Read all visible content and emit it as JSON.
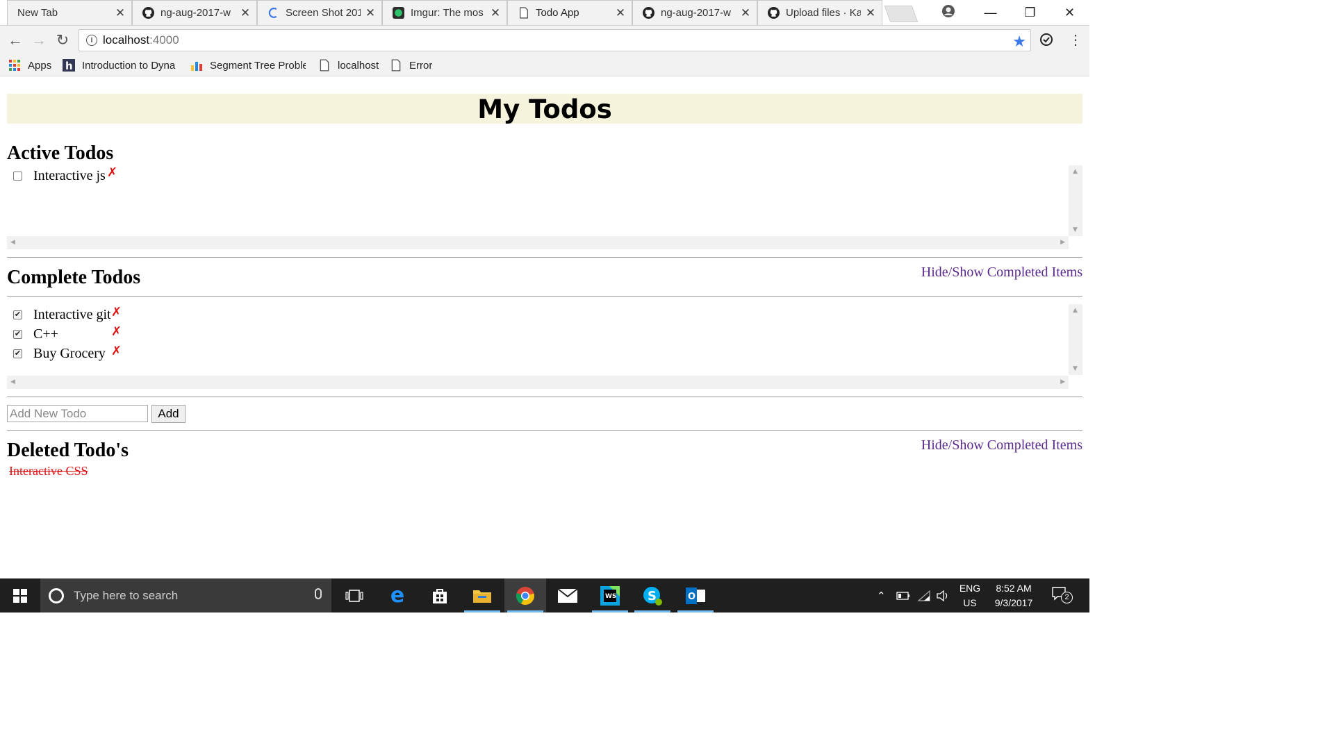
{
  "browser": {
    "tabs": [
      {
        "title": "New Tab",
        "icon": "none",
        "active": false
      },
      {
        "title": "ng-aug-2017-w",
        "icon": "github-icon",
        "active": false
      },
      {
        "title": "Screen Shot 201",
        "icon": "loading-icon",
        "active": false
      },
      {
        "title": "Imgur: The mos",
        "icon": "imgur-icon",
        "active": false
      },
      {
        "title": "Todo App",
        "icon": "page-icon",
        "active": true
      },
      {
        "title": "ng-aug-2017-w",
        "icon": "github-icon",
        "active": false
      },
      {
        "title": "Upload files · Ka",
        "icon": "github-icon",
        "active": false
      }
    ],
    "close_glyph": "✕",
    "address": {
      "host": "localhost",
      "port": ":4000"
    },
    "bookmarks": [
      {
        "label": "Apps",
        "icon": "apps-grid-icon"
      },
      {
        "label": "Introduction to Dyna",
        "icon": "hackerearth-icon"
      },
      {
        "label": "Segment Tree Proble",
        "icon": "bar-chart-icon"
      },
      {
        "label": "localhost",
        "icon": "page-icon"
      },
      {
        "label": "Error",
        "icon": "page-icon"
      }
    ]
  },
  "app": {
    "title": "My Todos",
    "active_heading": "Active Todos",
    "active_todos": [
      {
        "label": "Interactive js",
        "checked": false
      }
    ],
    "complete_heading": "Complete Todos",
    "toggle_label": "Hide/Show Completed Items",
    "complete_todos": [
      {
        "label": "Interactive git",
        "checked": true
      },
      {
        "label": "C++",
        "checked": true
      },
      {
        "label": "Buy Grocery",
        "checked": true
      }
    ],
    "new_todo_placeholder": "Add New Todo",
    "add_label": "Add",
    "deleted_heading": "Deleted Todo's",
    "deleted_todos": [
      "Interactive CSS"
    ],
    "delete_glyph": "✗"
  },
  "taskbar": {
    "search_placeholder": "Type here to search",
    "lang_top": "ENG",
    "lang_bottom": "US",
    "time": "8:52 AM",
    "date": "9/3/2017",
    "notification_count": "2"
  },
  "colors": {
    "banner_bg": "#f5f3dc",
    "delete_red": "#e01010",
    "link_purple": "#5b2a8c",
    "taskbar_bg": "#1f1f1f"
  }
}
